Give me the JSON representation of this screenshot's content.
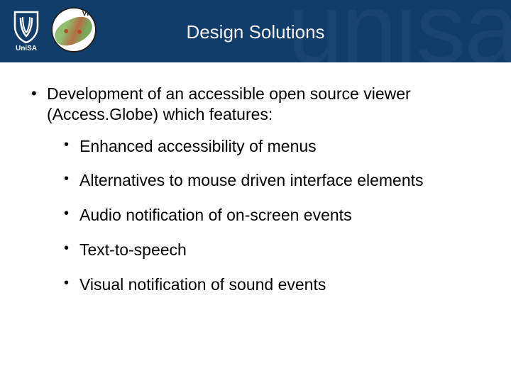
{
  "header": {
    "title": "Design Solutions",
    "watermark": "unisa",
    "logo_text": "UniSA",
    "circle_label": "VII"
  },
  "content": {
    "intro": "Development of an accessible open source viewer (Access.Globe) which features:",
    "bullets": [
      "Enhanced accessibility of menus",
      "Alternatives to mouse driven interface elements",
      "Audio notification of on-screen events",
      "Text-to-speech",
      "Visual notification of sound events"
    ]
  }
}
